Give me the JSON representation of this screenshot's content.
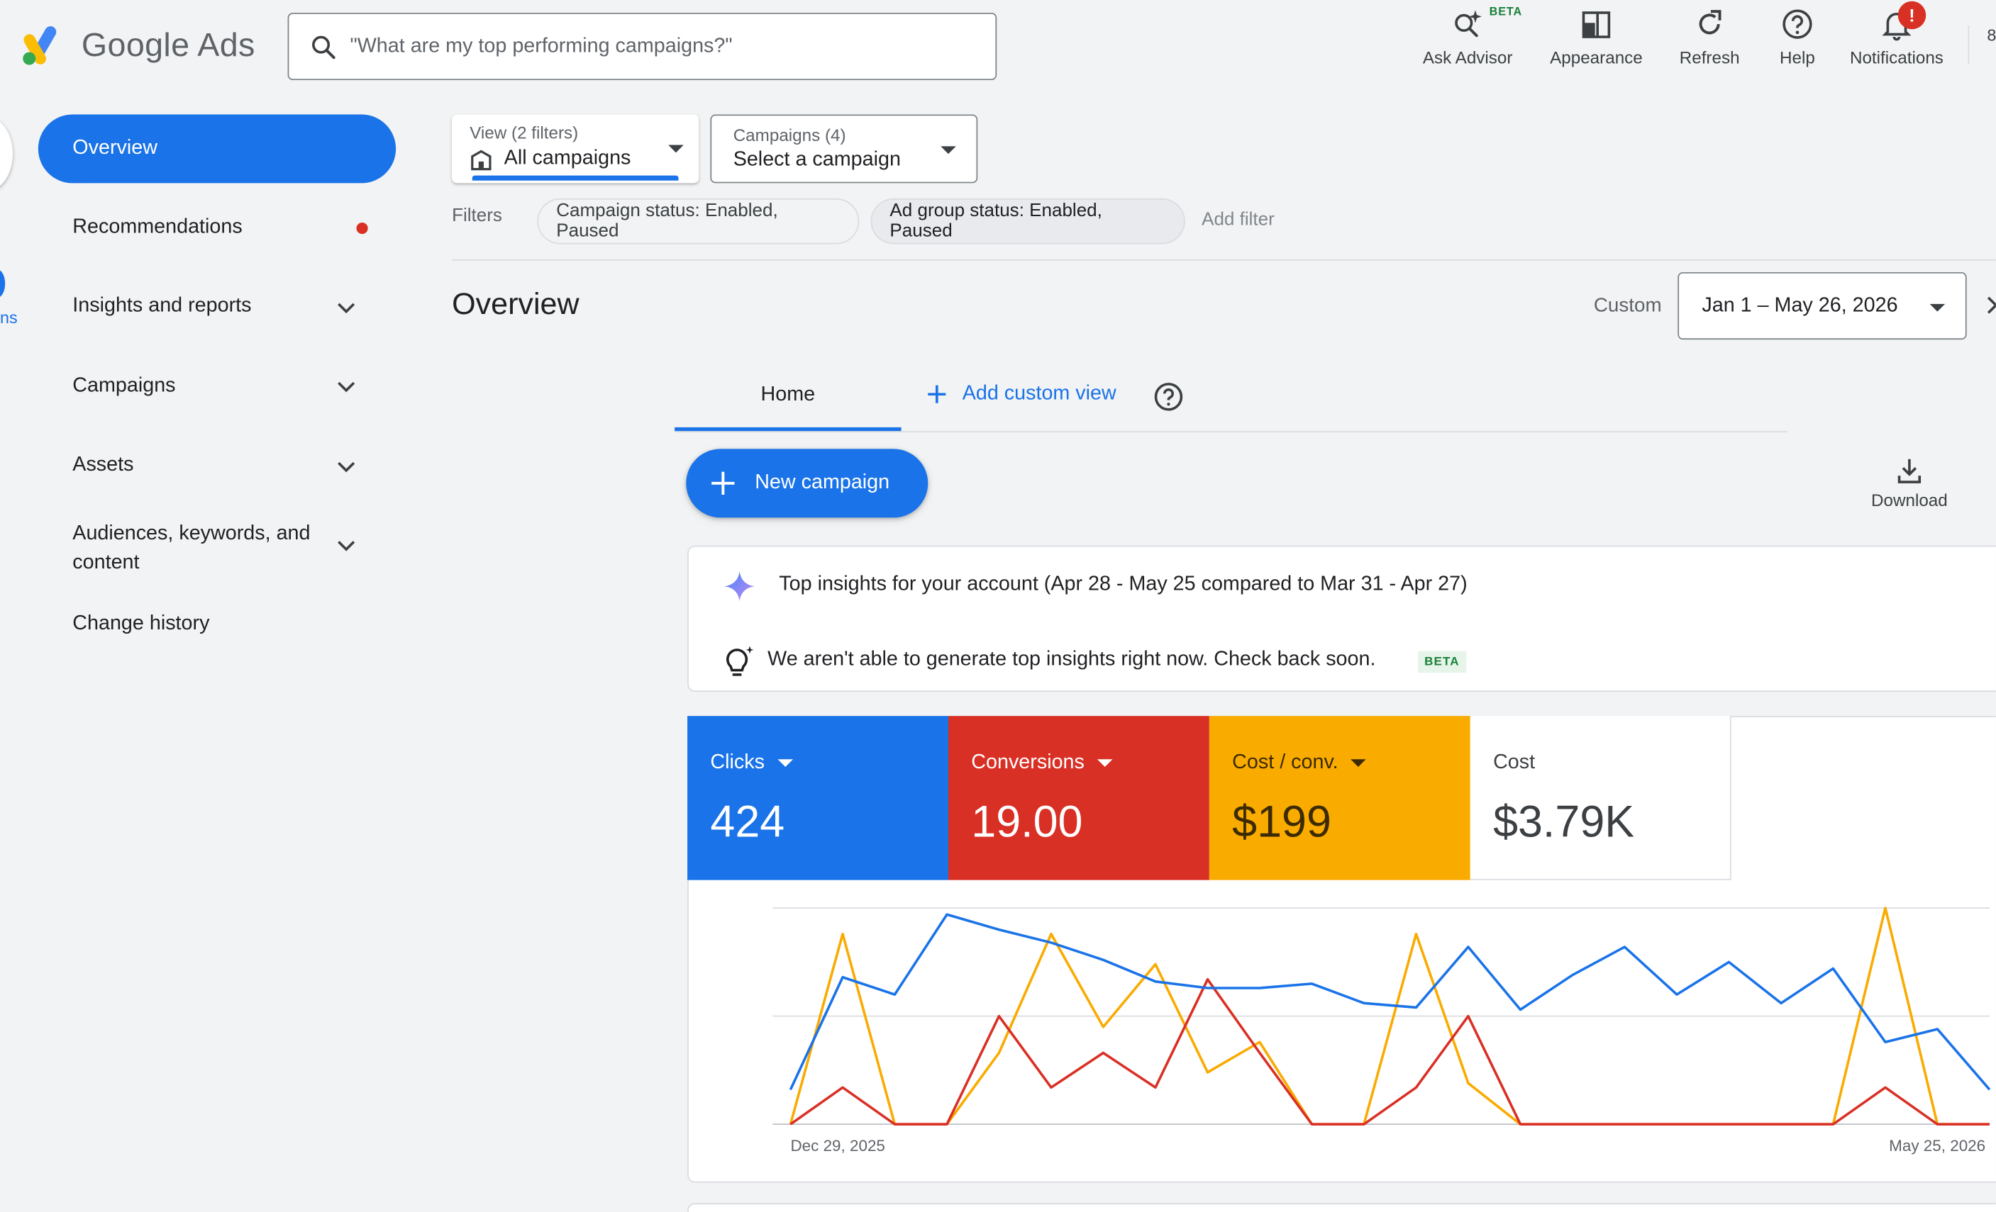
{
  "header": {
    "brand": "Google Ads",
    "search_placeholder": "\"What are my top performing campaigns?\"",
    "actions": {
      "ask_advisor": "Ask Advisor",
      "ask_advisor_beta": "BETA",
      "appearance": "Appearance",
      "refresh": "Refresh",
      "help": "Help",
      "notifications": "Notifications",
      "notifications_badge": "!"
    },
    "edge_char": "8"
  },
  "sidebar": {
    "partial_label": "ns",
    "items": [
      {
        "label": "Overview",
        "active": true
      },
      {
        "label": "Recommendations",
        "has_dot": true
      },
      {
        "label": "Insights and reports",
        "expandable": true
      },
      {
        "label": "Campaigns",
        "expandable": true
      },
      {
        "label": "Assets",
        "expandable": true
      },
      {
        "label": "Audiences, keywords, and",
        "label2": "content",
        "expandable": true
      },
      {
        "label": "Change history"
      }
    ]
  },
  "filters": {
    "view_label": "View (2 filters)",
    "view_value": "All campaigns",
    "campaigns_label": "Campaigns (4)",
    "campaigns_value": "Select a campaign",
    "filters_label": "Filters",
    "chips": [
      "Campaign status: Enabled, Paused",
      "Ad group status: Enabled, Paused"
    ],
    "add_filter": "Add filter"
  },
  "overview": {
    "title": "Overview",
    "range_type": "Custom",
    "date_range": "Jan 1 – May 26, 2026",
    "tabs": {
      "home": "Home",
      "add_custom_view": "Add custom view"
    },
    "new_campaign": "New campaign",
    "download": "Download"
  },
  "insights": {
    "title": "Top insights for your account (Apr 28 - May 25 compared to Mar 31 - Apr 27)",
    "message": "We aren't able to generate top insights right now. Check back soon.",
    "beta": "BETA"
  },
  "metrics": [
    {
      "label": "Clicks",
      "value": "424",
      "color": "#1a73e8",
      "dropdown": true
    },
    {
      "label": "Conversions",
      "value": "19.00",
      "color": "#d93025",
      "dropdown": true
    },
    {
      "label": "Cost / conv.",
      "value": "$199",
      "color": "#f9ab00",
      "dropdown": true
    },
    {
      "label": "Cost",
      "value": "$3.79K",
      "color": "#ffffff",
      "dropdown": false
    }
  ],
  "chart_data": {
    "type": "line",
    "x_start_label": "Dec 29, 2025",
    "x_end_label": "May 25, 2026",
    "grid": true,
    "y_max": 100,
    "series": [
      {
        "name": "Clicks",
        "color": "#1a73e8",
        "values": [
          16,
          68,
          60,
          97,
          90,
          84,
          76,
          66,
          63,
          63,
          65,
          56,
          54,
          82,
          53,
          69,
          82,
          60,
          75,
          56,
          72,
          38,
          44,
          16
        ]
      },
      {
        "name": "Conversions",
        "color": "#d93025",
        "values": [
          0,
          17,
          0,
          0,
          50,
          17,
          33,
          17,
          67,
          33,
          0,
          0,
          17,
          50,
          0,
          0,
          0,
          0,
          0,
          0,
          0,
          17,
          0,
          0
        ]
      },
      {
        "name": "Cost / conv.",
        "color": "#f9ab00",
        "values": [
          0,
          88,
          0,
          0,
          33,
          88,
          45,
          74,
          24,
          38,
          0,
          0,
          88,
          19,
          0,
          0,
          0,
          0,
          0,
          0,
          0,
          100,
          0,
          0
        ]
      }
    ]
  }
}
